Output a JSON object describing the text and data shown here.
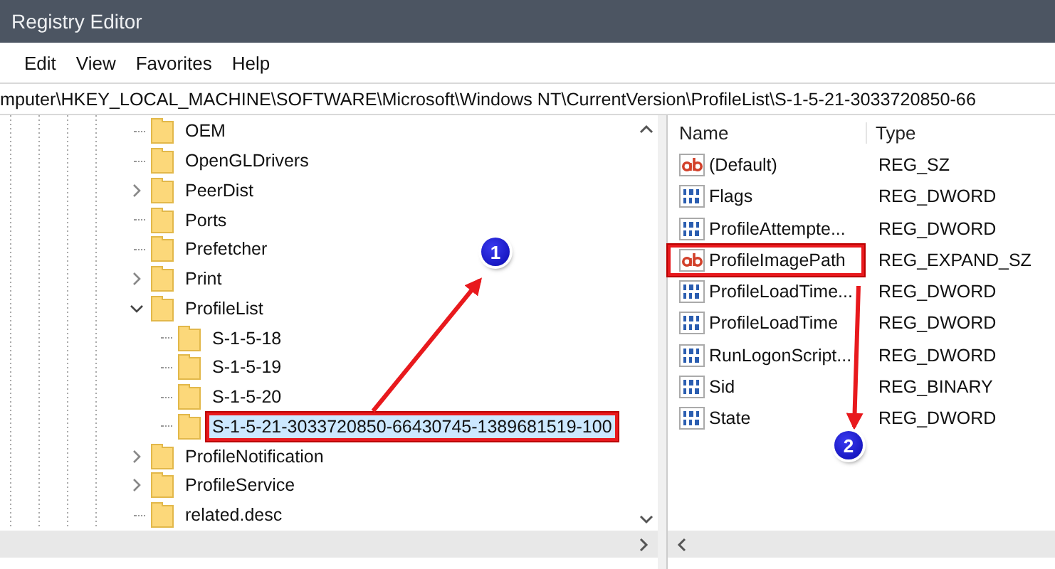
{
  "window": {
    "title": "Registry Editor"
  },
  "menu": [
    {
      "label": "Edit"
    },
    {
      "label": "View"
    },
    {
      "label": "Favorites"
    },
    {
      "label": "Help"
    }
  ],
  "address": "mputer\\HKEY_LOCAL_MACHINE\\SOFTWARE\\Microsoft\\Windows NT\\CurrentVersion\\ProfileList\\S-1-5-21-3033720850-66",
  "tree": {
    "items": [
      {
        "label": "OEM",
        "kind": "leaf",
        "selected": false,
        "highlighted": false
      },
      {
        "label": "OpenGLDrivers",
        "kind": "leaf",
        "selected": false,
        "highlighted": false
      },
      {
        "label": "PeerDist",
        "kind": "branch",
        "expanded": false,
        "selected": false,
        "highlighted": false
      },
      {
        "label": "Ports",
        "kind": "leaf",
        "selected": false,
        "highlighted": false
      },
      {
        "label": "Prefetcher",
        "kind": "leaf",
        "selected": false,
        "highlighted": false
      },
      {
        "label": "Print",
        "kind": "branch",
        "expanded": false,
        "selected": false,
        "highlighted": false
      },
      {
        "label": "ProfileList",
        "kind": "branch",
        "expanded": true,
        "selected": false,
        "highlighted": false,
        "children": [
          {
            "label": "S-1-5-18",
            "kind": "leaf",
            "selected": false,
            "highlighted": false
          },
          {
            "label": "S-1-5-19",
            "kind": "leaf",
            "selected": false,
            "highlighted": false
          },
          {
            "label": "S-1-5-20",
            "kind": "leaf",
            "selected": false,
            "highlighted": false
          },
          {
            "label": "S-1-5-21-3033720850-66430745-1389681519-100",
            "kind": "leaf",
            "selected": true,
            "highlighted": true
          }
        ]
      },
      {
        "label": "ProfileNotification",
        "kind": "branch",
        "expanded": false,
        "selected": false,
        "highlighted": false
      },
      {
        "label": "ProfileService",
        "kind": "branch",
        "expanded": false,
        "selected": false,
        "highlighted": false
      },
      {
        "label": "related.desc",
        "kind": "leaf",
        "selected": false,
        "highlighted": false
      }
    ]
  },
  "values": {
    "columns": [
      "Name",
      "Type"
    ],
    "rows": [
      {
        "kind": "string",
        "name": "(Default)",
        "type": "REG_SZ",
        "highlighted": false
      },
      {
        "kind": "binary",
        "name": "Flags",
        "type": "REG_DWORD",
        "highlighted": false
      },
      {
        "kind": "binary",
        "name": "ProfileAttempte...",
        "type": "REG_DWORD",
        "highlighted": false
      },
      {
        "kind": "string",
        "name": "ProfileImagePath",
        "type": "REG_EXPAND_SZ",
        "highlighted": true
      },
      {
        "kind": "binary",
        "name": "ProfileLoadTime...",
        "type": "REG_DWORD",
        "highlighted": false
      },
      {
        "kind": "binary",
        "name": "ProfileLoadTime",
        "type": "REG_DWORD",
        "highlighted": false
      },
      {
        "kind": "binary",
        "name": "RunLogonScript...",
        "type": "REG_DWORD",
        "highlighted": false
      },
      {
        "kind": "binary",
        "name": "Sid",
        "type": "REG_BINARY",
        "highlighted": false
      },
      {
        "kind": "binary",
        "name": "State",
        "type": "REG_DWORD",
        "highlighted": false
      }
    ]
  },
  "annotations": [
    {
      "label": "1"
    },
    {
      "label": "2"
    }
  ]
}
